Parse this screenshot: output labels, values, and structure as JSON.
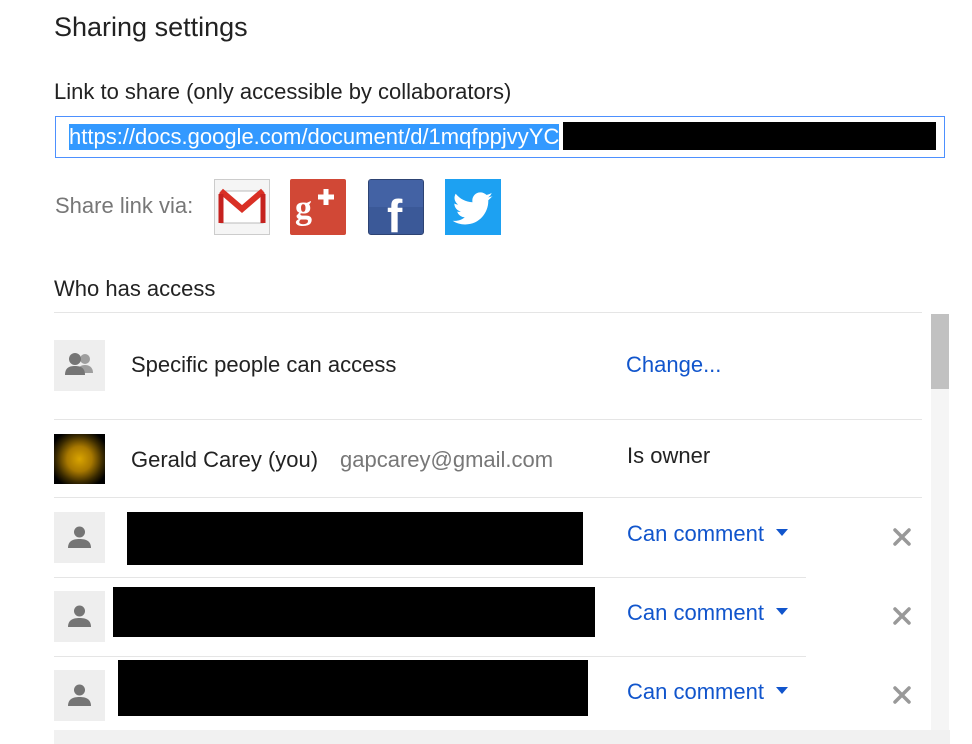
{
  "dialog": {
    "title": "Sharing settings",
    "link_label": "Link to share (only accessible by collaborators)",
    "link_value": "https://docs.google.com/document/d/1mqfppjvyYC",
    "share_via_label": "Share link via:",
    "share_icons": [
      "gmail-icon",
      "google-plus-icon",
      "facebook-icon",
      "twitter-icon"
    ],
    "who_has_access": "Who has access"
  },
  "access": {
    "label": "Specific people can access",
    "change_link": "Change..."
  },
  "collaborators": [
    {
      "name": "Gerald Carey (you)",
      "email": "gapcarey@gmail.com",
      "role": "Is owner"
    },
    {
      "role": "Can comment"
    },
    {
      "role": "Can comment"
    },
    {
      "role": "Can comment"
    }
  ],
  "colors": {
    "link_blue": "#1155cc",
    "selection_blue": "#3399ff",
    "focus_border": "#4d90fe"
  }
}
